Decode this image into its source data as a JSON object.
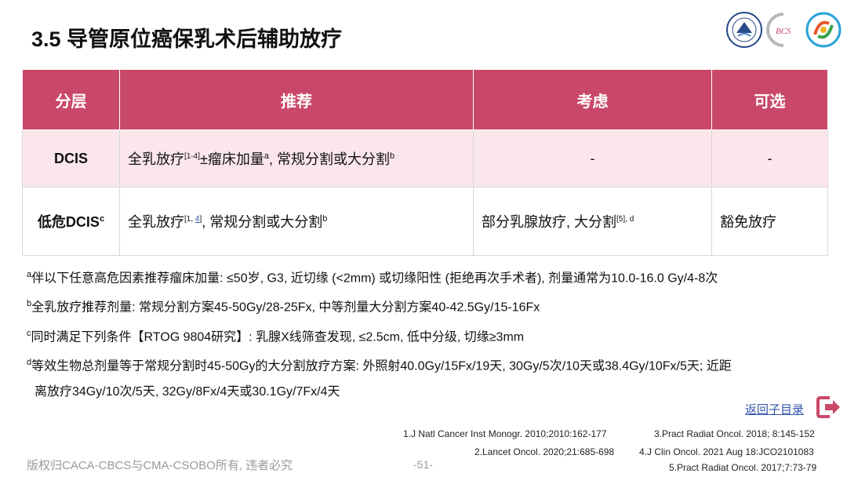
{
  "title": "3.5 导管原位癌保乳术后辅助放疗",
  "table": {
    "headers": [
      "分层",
      "推荐",
      "考虑",
      "可选"
    ],
    "rows": [
      {
        "layer": "DCIS",
        "rec_a": "全乳放疗",
        "rec_ref": "[1-4]",
        "rec_b": "±瘤床加量",
        "rec_sup": "a",
        "rec_c": ", 常规分割或大分割",
        "rec_sup2": "b",
        "consider": "-",
        "optional": "-"
      },
      {
        "layer": "低危DCIS",
        "layer_sup": "c",
        "rec_a": "全乳放疗",
        "rec_ref1": "[1, ",
        "rec_ref2": "4",
        "rec_ref3": "]",
        "rec_c": ", 常规分割或大分割",
        "rec_sup2": "b",
        "consider_a": "部分乳腺放疗, 大分割",
        "consider_ref": "[5], d",
        "optional": "豁免放疗"
      }
    ]
  },
  "notes": [
    {
      "sup": "a",
      "text": "伴以下任意高危因素推荐瘤床加量: ≤50岁, G3, 近切缘 (<2mm) 或切缘阳性 (拒绝再次手术者), 剂量通常为10.0-16.0 Gy/4-8次"
    },
    {
      "sup": "b",
      "text": "全乳放疗推荐剂量: 常规分割方案45-50Gy/28-25Fx, 中等剂量大分割方案40-42.5Gy/15-16Fx"
    },
    {
      "sup": "c",
      "text": "同时满足下列条件【RTOG 9804研究】: 乳腺X线筛查发现, ≤2.5cm, 低中分级, 切缘≥3mm"
    },
    {
      "sup": "d",
      "text": "等效生物总剂量等于常规分割时45-50Gy的大分割放疗方案: 外照射40.0Gy/15Fx/19天, 30Gy/5次/10天或38.4Gy/10Fx/5天; 近距"
    },
    {
      "sup": "",
      "text": "离放疗34Gy/10次/5天, 32Gy/8Fx/4天或30.1Gy/7Fx/4天"
    }
  ],
  "back_link": "返回子目录",
  "references": [
    "1.J Natl Cancer Inst Monogr. 2010;2010:162-177",
    "2.Lancet Oncol. 2020;21:685-698",
    "3.Pract Radiat Oncol. 2018; 8:145-152",
    "4.J Clin Oncol. 2021 Aug 18:JCO2101083",
    "5.Pract Radiat Oncol. 2017;7:73-79"
  ],
  "footer": {
    "copyright": "版权归CACA-CBCS与CMA-CSOBO所有, 违者必究",
    "page": "-51-"
  },
  "logos": {
    "logo2_text": "BCS"
  },
  "colors": {
    "header": "#c9486a",
    "row_tint": "#fbe6ec",
    "link": "#3355aa"
  }
}
